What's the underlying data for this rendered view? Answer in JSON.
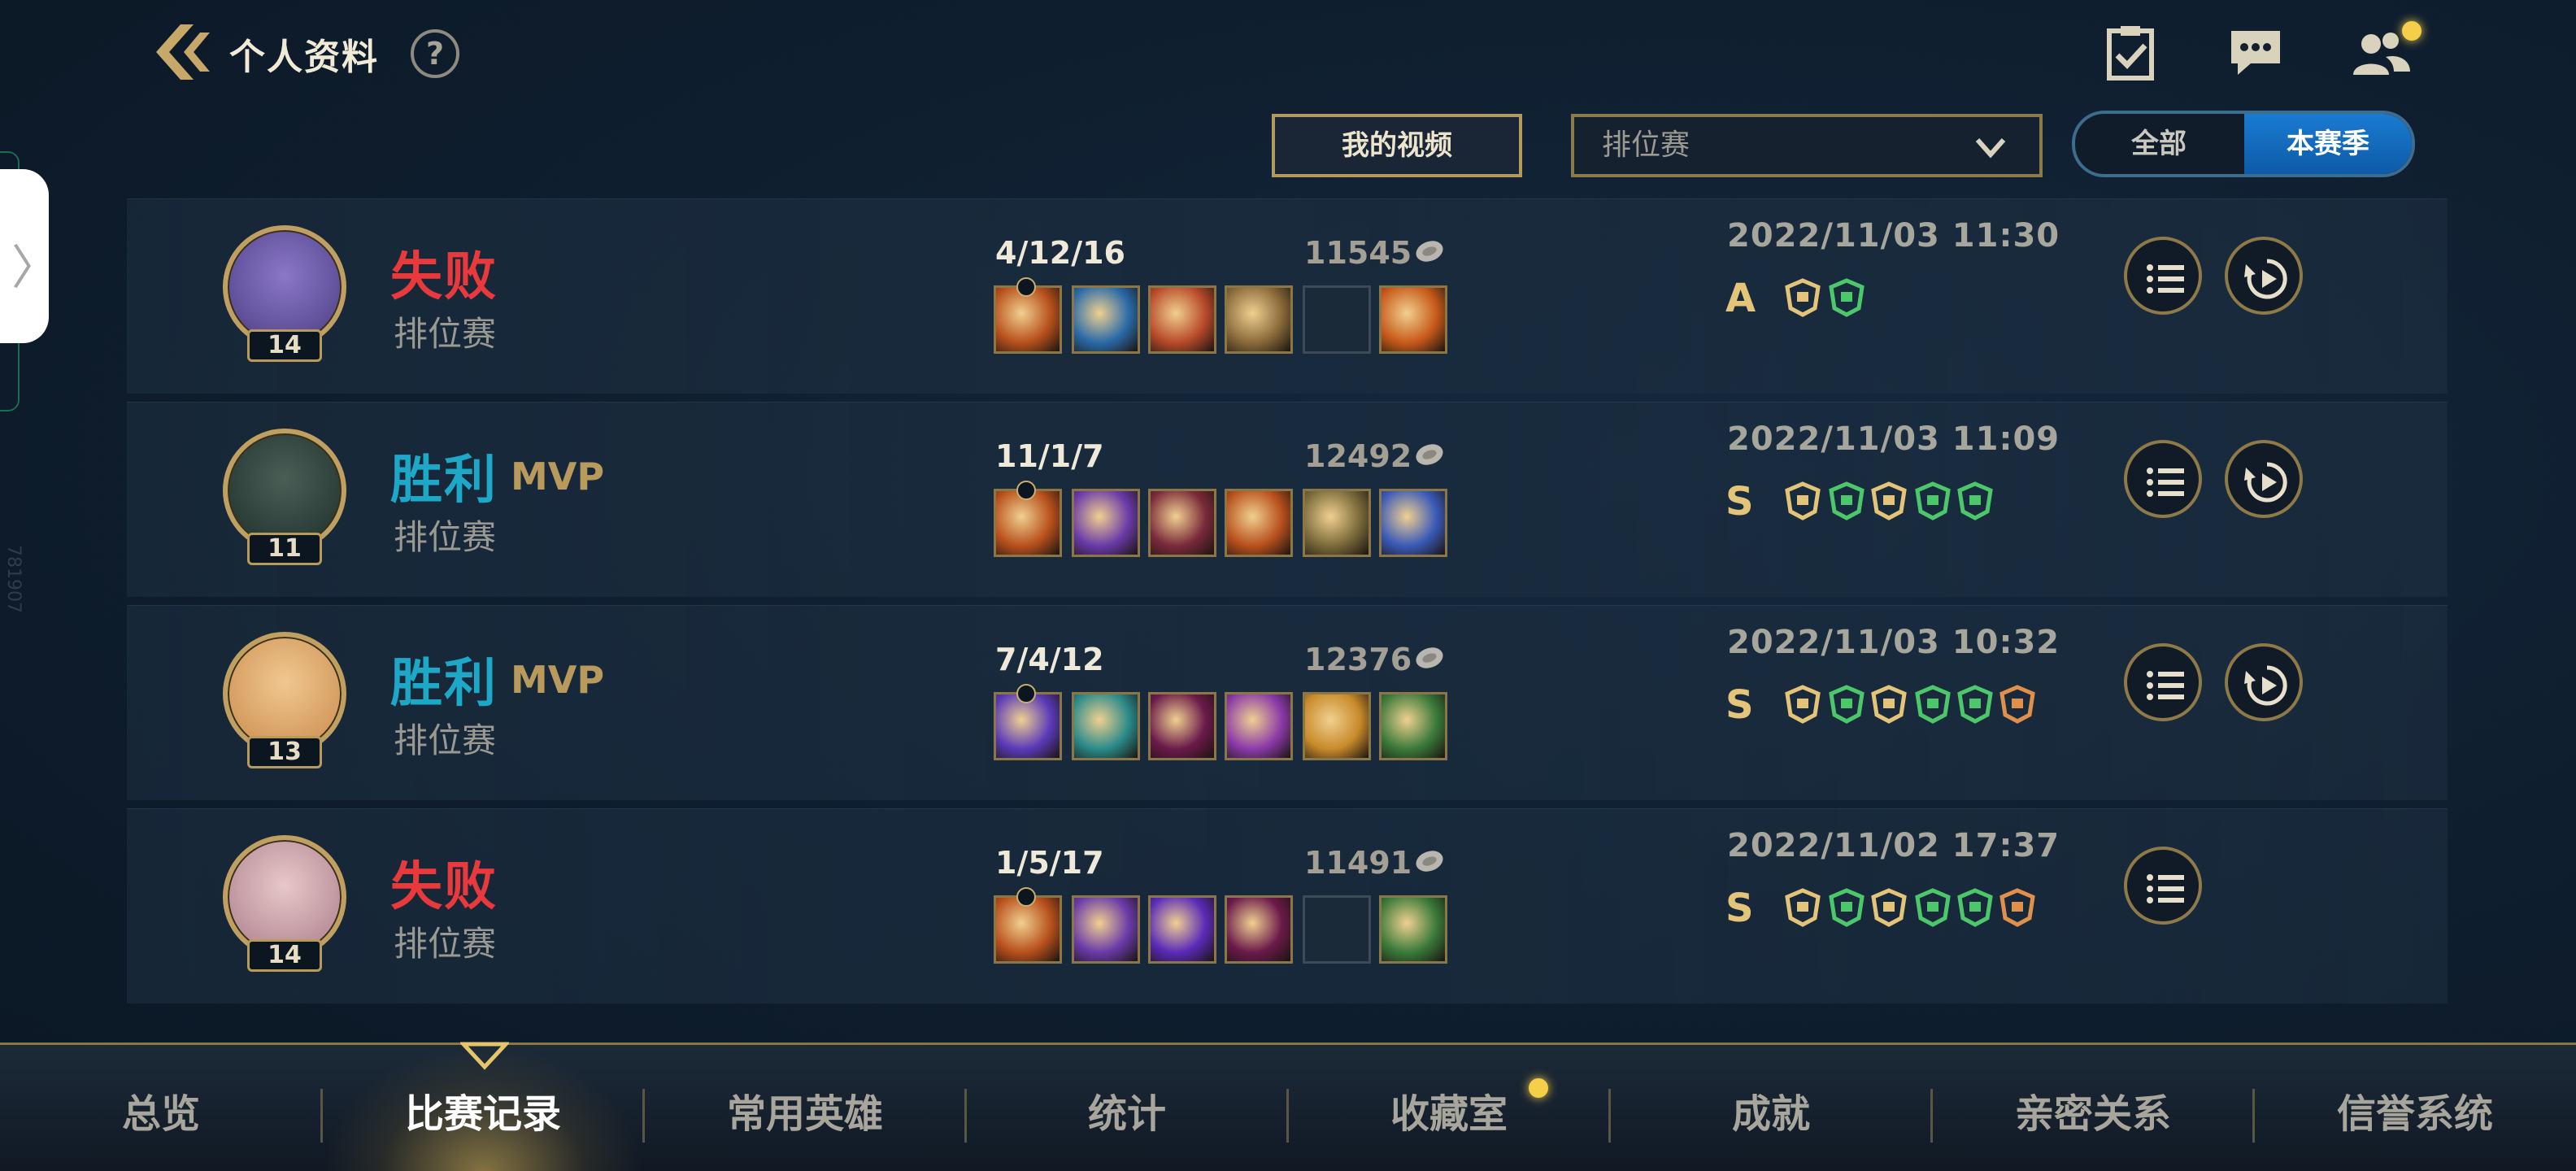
{
  "header": {
    "title": "个人资料",
    "help_label": "?"
  },
  "filters": {
    "video_label": "我的视频",
    "mode_selected": "排位赛",
    "season_options": [
      "全部",
      "本赛季"
    ],
    "season_selected": "本赛季"
  },
  "matches": [
    {
      "result": "失败",
      "result_type": "loss",
      "mvp": "",
      "queue": "排位赛",
      "level": "14",
      "kda": "4/12/16",
      "gold": "11545",
      "date": "2022/11/03 11:30",
      "grade": "A",
      "has_replay": true,
      "avatar_colors": [
        "#4a3a80",
        "#8a78c8"
      ],
      "item_colors": [
        "#b8501c",
        "#2a6aa8",
        "#b84a2a",
        "#8a6a3a",
        "",
        "#c85a1a"
      ],
      "badge_count": 2
    },
    {
      "result": "胜利",
      "result_type": "win",
      "mvp": "MVP",
      "queue": "排位赛",
      "level": "11",
      "kda": "11/1/7",
      "gold": "12492",
      "date": "2022/11/03 11:09",
      "grade": "S",
      "has_replay": true,
      "avatar_colors": [
        "#1e2e2a",
        "#4a5e56"
      ],
      "item_colors": [
        "#b8501c",
        "#6a3aa8",
        "#7a2a3a",
        "#b8501c",
        "#7a6a3a",
        "#3a5ab8"
      ],
      "badge_count": 5
    },
    {
      "result": "胜利",
      "result_type": "win",
      "mvp": "MVP",
      "queue": "排位赛",
      "level": "13",
      "kda": "7/4/12",
      "gold": "12376",
      "date": "2022/11/03 10:32",
      "grade": "S",
      "has_replay": true,
      "avatar_colors": [
        "#c8884a",
        "#f0c890"
      ],
      "item_colors": [
        "#5a3ab8",
        "#2a8a8a",
        "#6a1a4a",
        "#8a3aa8",
        "#c88a2a",
        "#3a7a3a"
      ],
      "badge_count": 6
    },
    {
      "result": "失败",
      "result_type": "loss",
      "mvp": "",
      "queue": "排位赛",
      "level": "14",
      "kda": "1/5/17",
      "gold": "11491",
      "date": "2022/11/02 17:37",
      "grade": "S",
      "has_replay": false,
      "avatar_colors": [
        "#a87a8a",
        "#e8c8c8"
      ],
      "item_colors": [
        "#b8501c",
        "#6a3aa8",
        "#5a2ab8",
        "#6a1a4a",
        "",
        "#3a7a3a"
      ],
      "badge_count": 6
    }
  ],
  "nav": {
    "items": [
      "总览",
      "比赛记录",
      "常用英雄",
      "统计",
      "收藏室",
      "成就",
      "亲密关系",
      "信誉系统"
    ],
    "active_index": 1
  },
  "side": {
    "tab_glyph": "〉",
    "watermark": "781907"
  },
  "colors": {
    "loss": "#e8393c",
    "win": "#1ea8c8",
    "gold_trim": "#b79a5c",
    "accent_blue": "#1a7bd0"
  }
}
